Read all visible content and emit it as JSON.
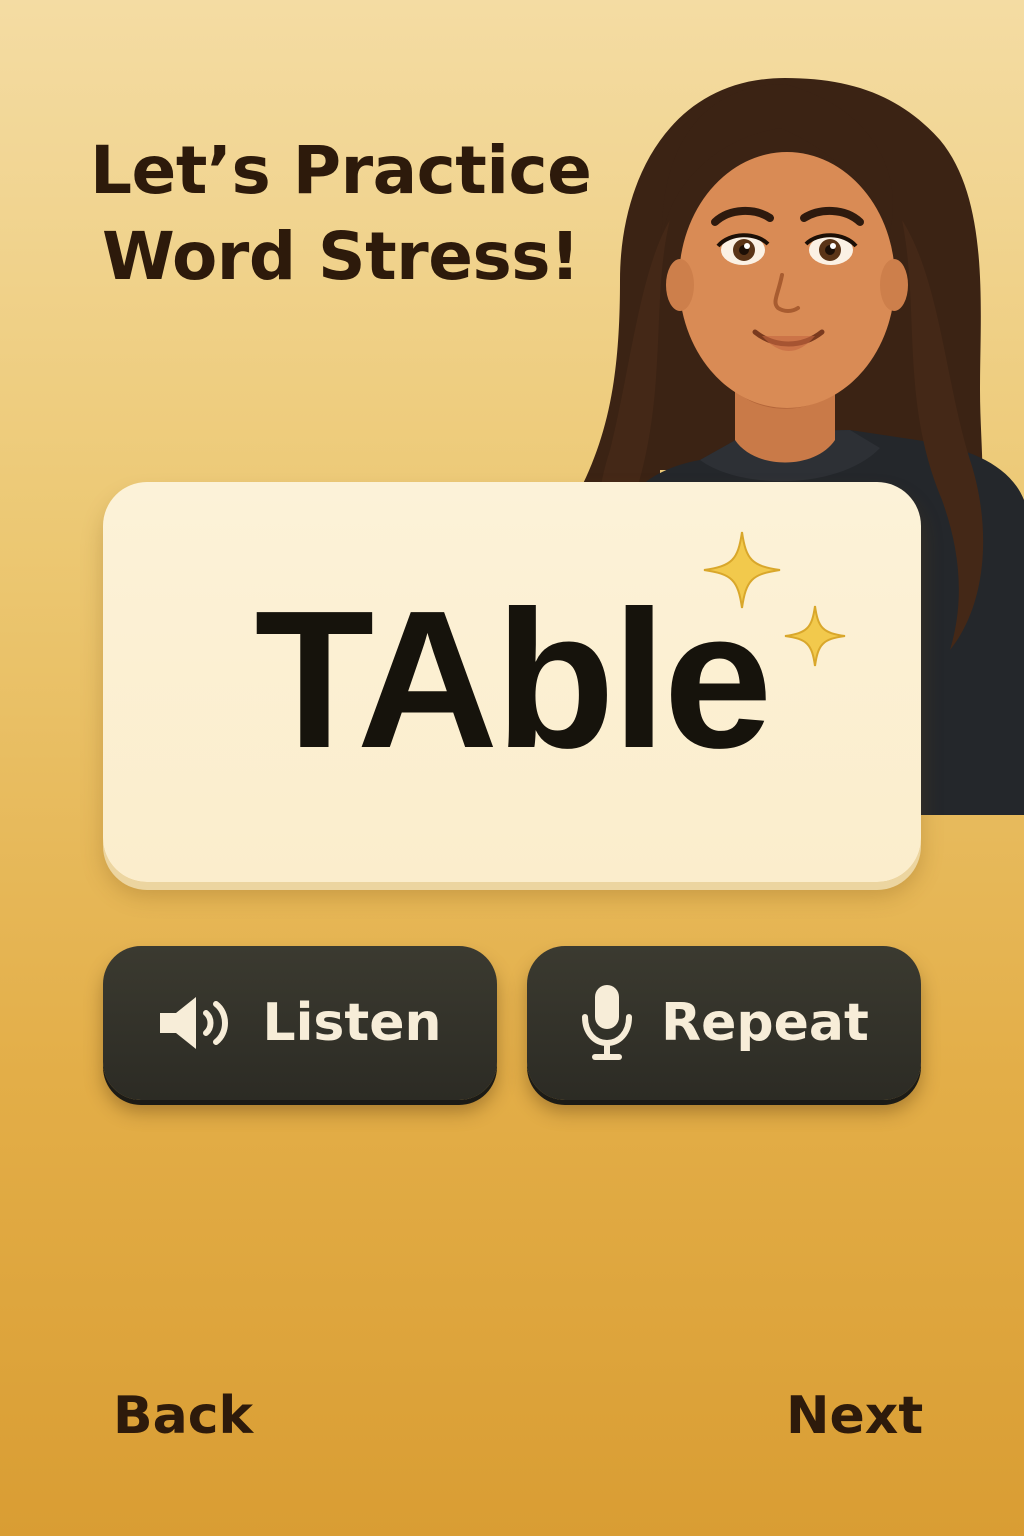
{
  "header": {
    "title_line1": "Let’s Practice",
    "title_line2": "Word Stress!"
  },
  "word_card": {
    "word": "TAble",
    "accent_color": "#f0c84a"
  },
  "actions": {
    "listen_label": "Listen",
    "listen_icon": "speaker-icon",
    "repeat_label": "Repeat",
    "repeat_icon": "microphone-icon"
  },
  "navigation": {
    "back_label": "Back",
    "next_label": "Next"
  },
  "theme": {
    "background_top": "#f4dca3",
    "background_bottom": "#d99d33",
    "button_color": "#2f2e27",
    "card_color": "#fcf2d8",
    "text_dark": "#2d1a0b"
  }
}
